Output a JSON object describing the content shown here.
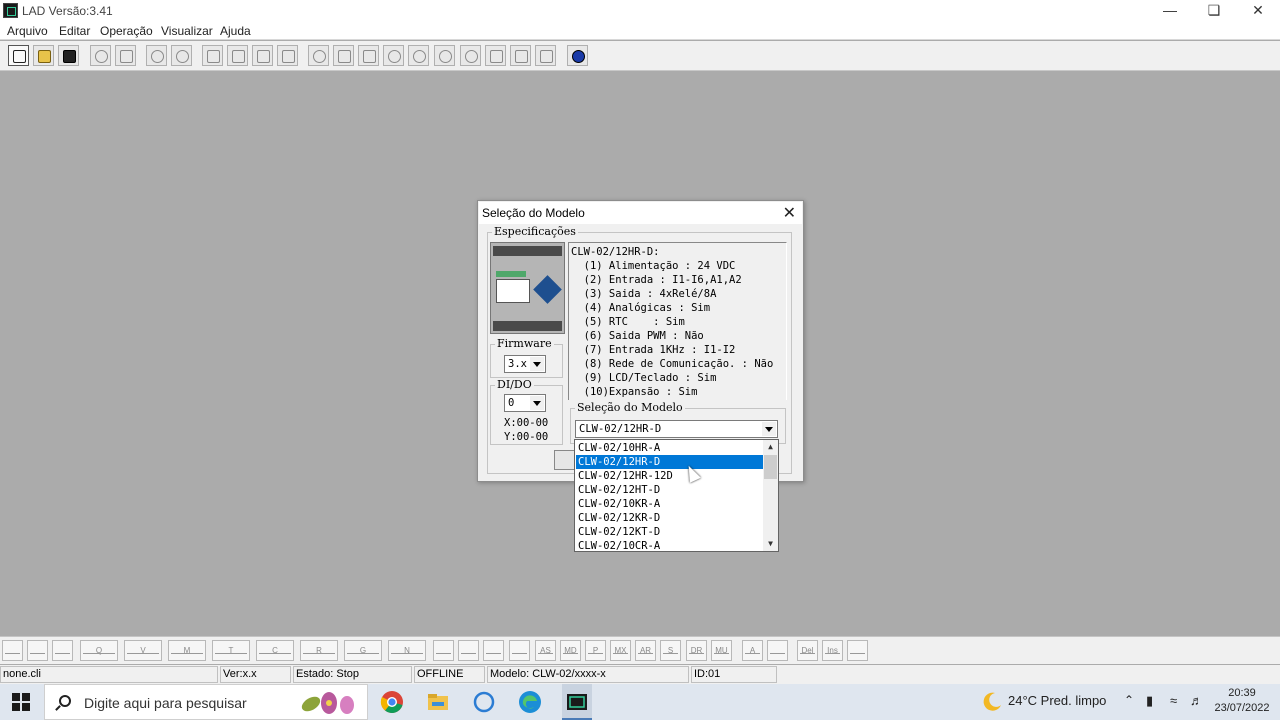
{
  "app": {
    "title": "LAD Versão:3.41"
  },
  "menu": [
    "Arquivo",
    "Editar",
    "Operação",
    "Visualizar",
    "Ajuda"
  ],
  "dialog": {
    "title": "Seleção do Modelo",
    "specs_label": "Especificações",
    "spec_lines": [
      "CLW-02/12HR-D:",
      "  (1) Alimentação : 24 VDC",
      "  (2) Entrada : I1-I6,A1,A2",
      "  (3) Saida : 4xRelé/8A",
      "  (4) Analógicas : Sim",
      "  (5) RTC    : Sim",
      "  (6) Saida PWM : Não",
      "  (7) Entrada 1KHz : I1-I2",
      "  (8) Rede de Comunicação. : Não",
      "  (9) LCD/Teclado : Sim",
      "  (10)Expansão : Sim"
    ],
    "firmware_label": "Firmware",
    "firmware_value": "3.x",
    "dido_label": "DI/DO",
    "dido_value": "0",
    "x_range": "X:00-00",
    "y_range": "Y:00-00",
    "model_label": "Seleção do Modelo",
    "model_value": "CLW-02/12HR-D"
  },
  "dropdown": {
    "items": [
      "CLW-02/10HR-A",
      "CLW-02/12HR-D",
      "CLW-02/12HR-12D",
      "CLW-02/12HT-D",
      "CLW-02/10KR-A",
      "CLW-02/12KR-D",
      "CLW-02/12KT-D",
      "CLW-02/10CR-A"
    ],
    "selected": "CLW-02/12HR-D"
  },
  "statusbar": {
    "file": "none.cli",
    "version": "Ver:x.x",
    "state": "Estado: Stop",
    "connection": "OFFLINE",
    "model": "Modelo: CLW-02/xxxx-x",
    "id": "ID:01"
  },
  "ladder_labels": [
    "Q",
    "V",
    "M",
    "T",
    "C",
    "R",
    "G",
    "N",
    "AS",
    "MD",
    "P",
    "MX",
    "AR",
    "S",
    "DR",
    "MU",
    "A",
    "Del",
    "Ins"
  ],
  "taskbar": {
    "search_placeholder": "Digite aqui para pesquisar",
    "weather": "24°C  Pred. limpo",
    "time": "20:39",
    "date": "23/07/2022"
  },
  "icons": {
    "close": "close-icon",
    "minimize": "minimize-icon",
    "restore": "restore-icon",
    "dropdown": "chevron-down-icon",
    "search": "search-icon"
  },
  "colors": {
    "workspace": "#ababab",
    "selection": "#0078d7",
    "taskbar": "#dfe6ef"
  }
}
